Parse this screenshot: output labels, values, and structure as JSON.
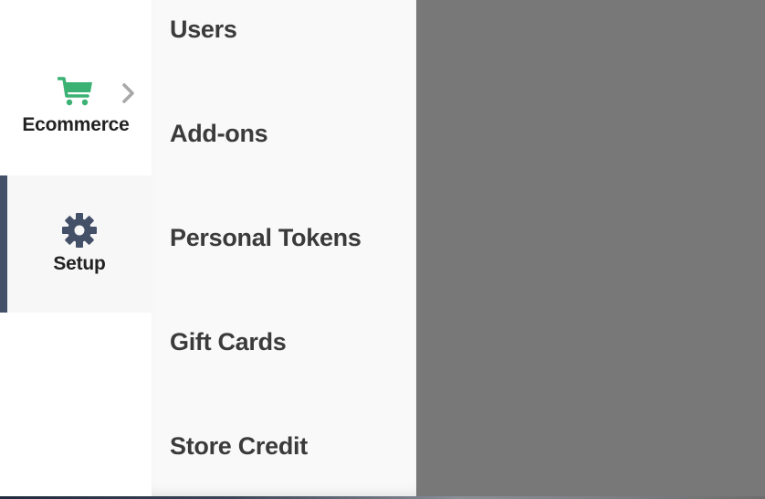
{
  "rail": {
    "items": [
      {
        "label": "Ecommerce",
        "icon": "cart-icon",
        "color": "#3bb273",
        "has_submenu_arrow": true
      },
      {
        "label": "Setup",
        "icon": "gear-icon",
        "color": "#445068",
        "active": true
      }
    ]
  },
  "submenu": {
    "items": [
      {
        "label": "Users"
      },
      {
        "label": "Add-ons"
      },
      {
        "label": "Personal Tokens"
      },
      {
        "label": "Gift Cards"
      },
      {
        "label": "Store Credit"
      }
    ]
  },
  "colors": {
    "accent_active": "#445068",
    "cart_green": "#3bb273",
    "overlay": "#787878",
    "submenu_bg": "#f9f9f9"
  }
}
